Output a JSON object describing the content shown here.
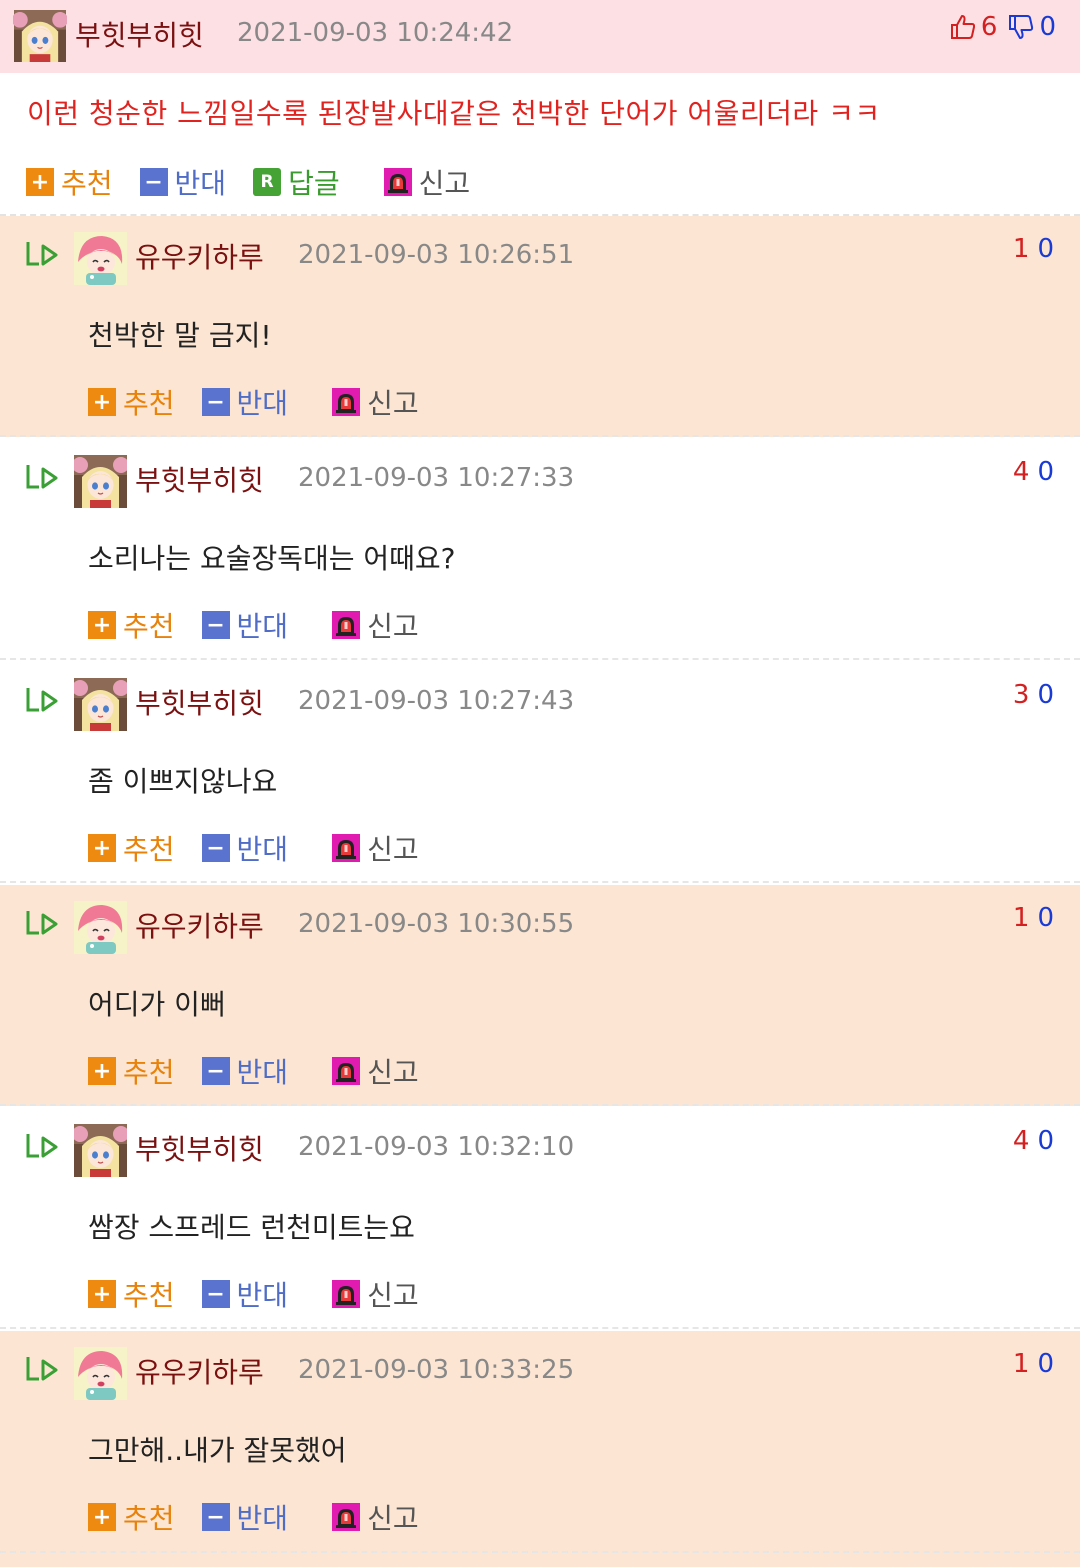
{
  "main_comment": {
    "author": "부힛부히힛",
    "timestamp": "2021-09-03 10:24:42",
    "upvotes": "6",
    "downvotes": "0",
    "body": "이런 청순한 느낌일수록 된장발사대같은 천박한 단어가 어울리더라 ㅋㅋ",
    "actions": {
      "recommend": "추천",
      "oppose": "반대",
      "reply": "답글",
      "report": "신고"
    },
    "icons": {
      "recommend_box": "+",
      "oppose_box": "−",
      "reply_box": "R"
    }
  },
  "reply_actions": {
    "recommend": "추천",
    "oppose": "반대",
    "report": "신고"
  },
  "replies": [
    {
      "author": "유우키하루",
      "timestamp": "2021-09-03 10:26:51",
      "up": "1",
      "down": "0",
      "body": "천박한 말 금지!"
    },
    {
      "author": "부힛부히힛",
      "timestamp": "2021-09-03 10:27:33",
      "up": "4",
      "down": "0",
      "body": "소리나는 요술장독대는 어때요?"
    },
    {
      "author": "부힛부히힛",
      "timestamp": "2021-09-03 10:27:43",
      "up": "3",
      "down": "0",
      "body": "좀 이쁘지않나요"
    },
    {
      "author": "유우키하루",
      "timestamp": "2021-09-03 10:30:55",
      "up": "1",
      "down": "0",
      "body": "어디가 이뻐"
    },
    {
      "author": "부힛부히힛",
      "timestamp": "2021-09-03 10:32:10",
      "up": "4",
      "down": "0",
      "body": "쌈장 스프레드 런천미트는요"
    },
    {
      "author": "유우키하루",
      "timestamp": "2021-09-03 10:33:25",
      "up": "1",
      "down": "0",
      "body": "그만해..내가 잘못했어"
    }
  ],
  "colors": {
    "main_header_bg": "#fde0e3",
    "peach_bg": "#fce6d3",
    "author": "#7a1010",
    "main_body": "#e0231f",
    "upvote": "#d42020",
    "downvote": "#1a3ad6",
    "recommend": "#ee8a10",
    "oppose": "#5a73cf",
    "reply": "#45a335",
    "report": "#e21bb0"
  }
}
